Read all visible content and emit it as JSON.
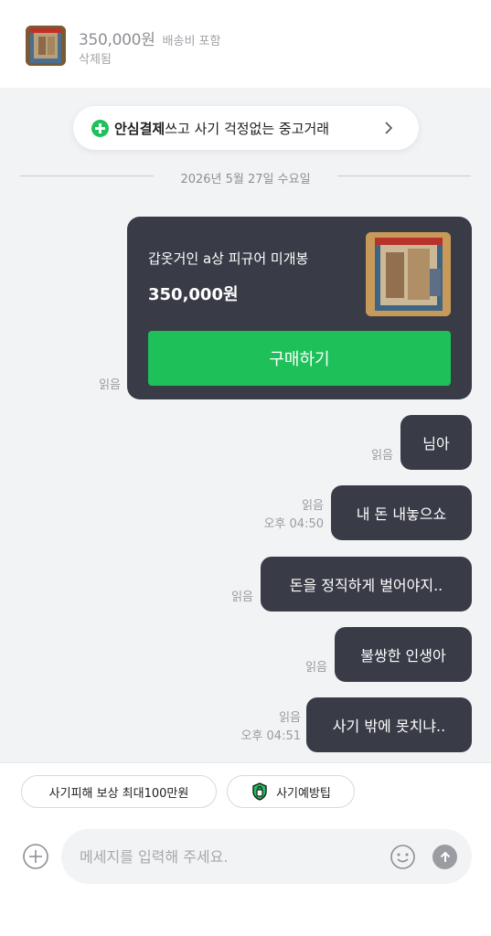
{
  "header": {
    "price": "350,000원",
    "shipping": "배송비 포함",
    "status": "삭제됨",
    "thumbnail_icon": "product-thumbnail"
  },
  "safe_pay_banner": {
    "bold_text": "안심결제",
    "rest_text": "쓰고 사기 걱정없는 중고거래",
    "icon": "plus-icon",
    "accent": "#20c05c"
  },
  "date_divider": "2026년 5월 27일 수요일",
  "product_card": {
    "title": "갑옷거인 a상 피규어 미개봉",
    "price": "350,000원",
    "button": "구매하기",
    "read": "읽음",
    "button_color": "#1ec159",
    "card_color": "#393c47"
  },
  "messages": [
    {
      "text": "님아",
      "read": "읽음",
      "time": ""
    },
    {
      "text": "내 돈 내놓으쇼",
      "read": "읽음",
      "time": "오후 04:50"
    },
    {
      "text": "돈을 정직하게 벌어야지..",
      "read": "읽음",
      "time": ""
    },
    {
      "text": "불쌍한 인생아",
      "read": "읽음",
      "time": ""
    },
    {
      "text": "사기 밖에 못치냐..",
      "read": "읽음",
      "time": "오후 04:51"
    }
  ],
  "chips": {
    "compensation": "사기피해 보상 최대100만원",
    "tips": "사기예방팁"
  },
  "composer": {
    "placeholder": "메세지를 입력해 주세요.",
    "add_icon": "plus-circle-icon",
    "emoji_icon": "smile-icon",
    "send_icon": "send-arrow-icon"
  }
}
